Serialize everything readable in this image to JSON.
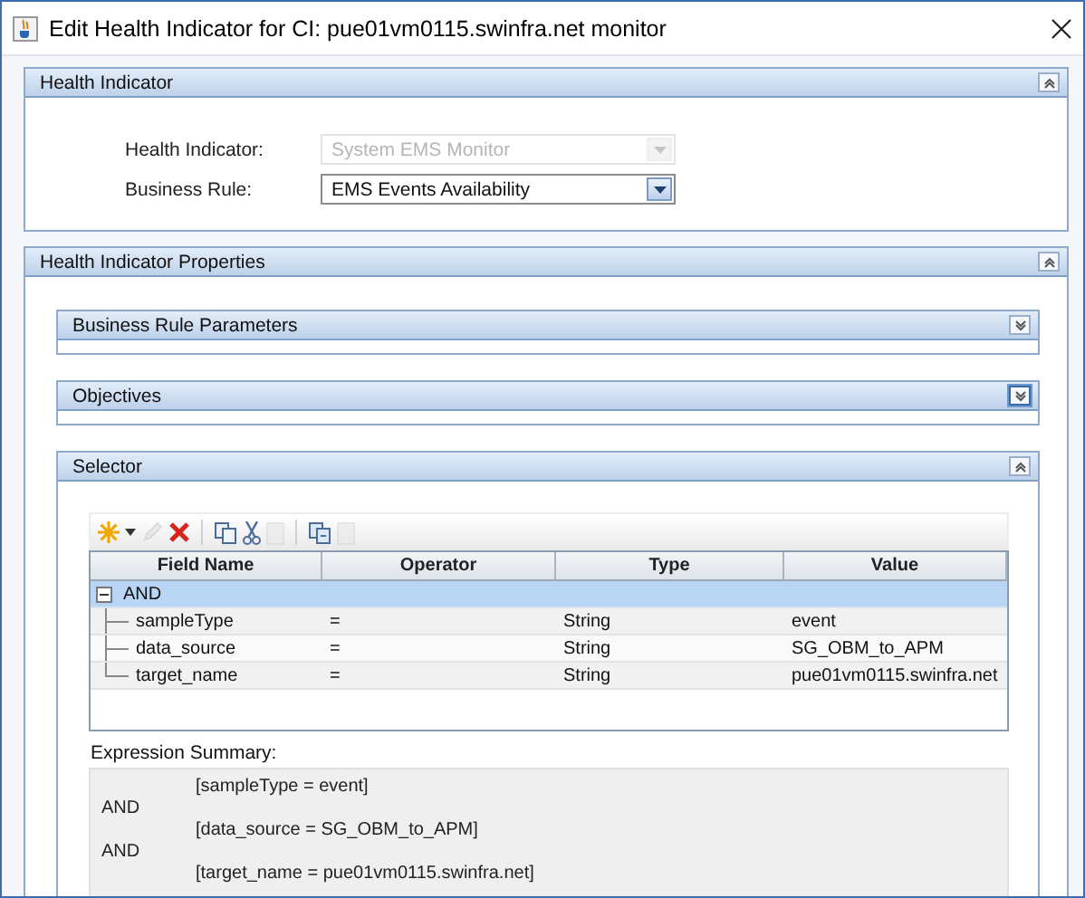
{
  "window": {
    "title": "Edit Health Indicator for CI: pue01vm0115.swinfra.net monitor"
  },
  "health_indicator_panel": {
    "title": "Health Indicator",
    "expanded": true,
    "fields": [
      {
        "label": "Health Indicator:",
        "value": "System EMS Monitor",
        "disabled": true
      },
      {
        "label": "Business Rule:",
        "value": "EMS Events Availability",
        "disabled": false
      }
    ]
  },
  "properties_panel": {
    "title": "Health Indicator Properties",
    "expanded": true,
    "subpanels": [
      {
        "title": "Business Rule Parameters",
        "expanded": false,
        "focused": false
      },
      {
        "title": "Objectives",
        "expanded": false,
        "focused": true
      },
      {
        "title": "Selector",
        "expanded": true,
        "focused": false
      }
    ]
  },
  "selector": {
    "toolbar": [
      {
        "kind": "new",
        "disabled": false
      },
      {
        "kind": "caret",
        "disabled": false
      },
      {
        "kind": "edit",
        "disabled": true
      },
      {
        "kind": "delete",
        "disabled": false
      },
      {
        "kind": "sep"
      },
      {
        "kind": "copy",
        "disabled": false
      },
      {
        "kind": "cut",
        "disabled": false
      },
      {
        "kind": "paste",
        "disabled": true
      },
      {
        "kind": "sep"
      },
      {
        "kind": "duplicate",
        "disabled": false
      },
      {
        "kind": "paste",
        "disabled": true
      }
    ],
    "columns": [
      "Field Name",
      "Operator",
      "Type",
      "Value"
    ],
    "tree": [
      {
        "label": "AND",
        "expanded": true,
        "selected": true,
        "children": [
          {
            "cells": [
              "sampleType",
              "=",
              "String",
              "event"
            ],
            "selected": false
          },
          {
            "cells": [
              "data_source",
              "=",
              "String",
              "SG_OBM_to_APM"
            ],
            "selected": false
          },
          {
            "cells": [
              "target_name",
              "=",
              "String",
              "pue01vm0115.swinfra.net"
            ],
            "selected": false
          }
        ]
      }
    ],
    "summary_label": "Expression Summary:",
    "summary_lines": [
      {
        "kind": "condition",
        "text": "[sampleType = event]"
      },
      {
        "kind": "operator",
        "text": "AND"
      },
      {
        "kind": "condition",
        "text": "[data_source = SG_OBM_to_APM]"
      },
      {
        "kind": "operator",
        "text": "AND"
      },
      {
        "kind": "condition",
        "text": "[target_name = pue01vm0115.swinfra.net]"
      }
    ]
  }
}
